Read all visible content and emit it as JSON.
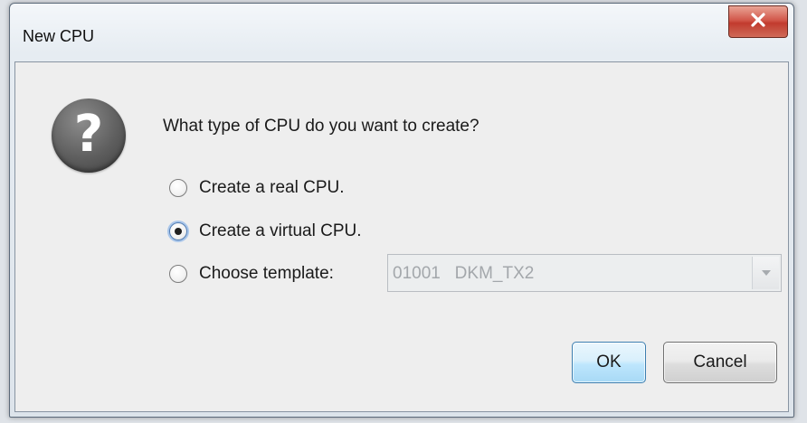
{
  "window": {
    "title": "New CPU",
    "close_icon": "close-icon"
  },
  "dialog": {
    "icon": "question-icon",
    "icon_glyph": "?",
    "message": "What type of CPU do you want to create?",
    "options": [
      {
        "label": "Create a real CPU.",
        "selected": false
      },
      {
        "label": "Create a virtual CPU.",
        "selected": true
      },
      {
        "label": "Choose template:",
        "selected": false
      }
    ],
    "template_select": {
      "value": "01001   DKM_TX2",
      "enabled": false,
      "arrow_icon": "chevron-down-icon"
    },
    "buttons": {
      "ok_label": "OK",
      "cancel_label": "Cancel"
    }
  },
  "colors": {
    "close_button": "#c94a3c",
    "ok_button": "#bee6fd",
    "focus_ring": "#a9c6ea"
  }
}
